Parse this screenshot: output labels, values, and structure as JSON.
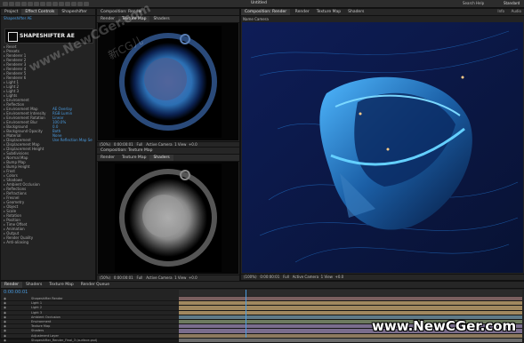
{
  "app": {
    "title": "Untitled",
    "workspace": "Standard",
    "search_placeholder": "Search Help"
  },
  "project_panel": {
    "tabs": [
      "Project",
      "Effect Controls",
      "Shapeshifter"
    ],
    "layer_title": "Shapeshifter AE",
    "logo_text": "SHAPESHIFTER AE",
    "rows": [
      "Reset",
      "Presets",
      "Renderer 1",
      "Renderer 2",
      "Renderer 3",
      "Renderer 4",
      "Renderer 5",
      "Renderer 6",
      "Light 1",
      "Light 2",
      "Light 3",
      "Lights",
      "Environment",
      "Reflection",
      "Environment Map",
      "Environment Intensity",
      "Environment Rotation",
      "Environment Blur",
      "Background",
      "Background Opacity",
      "Material",
      "Displacement",
      "Displacement Map",
      "Displacement Height",
      "Subdivisions",
      "Normal Map",
      "Bump Map",
      "Bump Height",
      "Frost",
      "Colors",
      "Shadows",
      "Ambient Occlusion",
      "Reflections",
      "Refractions",
      "Fresnel",
      "Geometry",
      "Object",
      "Scale",
      "Rotation",
      "Position",
      "Time Offset",
      "Animation",
      "Output",
      "Render Quality",
      "Anti-aliasing"
    ],
    "values": [
      "AE Overlay",
      "RGB Lumin",
      "Linear",
      "100.0%",
      "0.0",
      "Both",
      "None",
      "Use Reflection Map Settings"
    ]
  },
  "comp_top": {
    "tabs": [
      "Render",
      "Texture Map",
      "Shaders"
    ],
    "title": "Composition: Render",
    "footer": [
      "(50%)",
      "0:00:00:01",
      "Full",
      "Active Camera",
      "1 View",
      "+0.0"
    ]
  },
  "comp_bottom": {
    "tabs": [
      "Render",
      "Texture Map",
      "Shaders"
    ],
    "title": "Composition: Texture Map",
    "footer": [
      "(50%)",
      "0:00:00:01",
      "Full",
      "Active Camera",
      "1 View",
      "+0.0"
    ]
  },
  "comp_right": {
    "tabs": [
      "Render",
      "Texture Map",
      "Shaders"
    ],
    "title": "Composition: Render",
    "layer_label": "Name Camera",
    "side_labels": [
      "Info",
      "Audio"
    ],
    "footer": [
      "(100%)",
      "0:00:00:01",
      "Full",
      "Active Camera",
      "1 View",
      "+0.0"
    ]
  },
  "timeline": {
    "tabs": [
      "Render",
      "Shaders",
      "Texture Map",
      "Render Queue"
    ],
    "timecode": "0:00:00:01",
    "layers": [
      "Shapeshifter Render",
      "Light 1",
      "Light 2",
      "Light 3",
      "Ambient Occlusion",
      "Environment",
      "Texture Map",
      "Shaders",
      "Adjustment Layer",
      "Shapeshifter_Render_Final_3 (surface.psd)"
    ]
  },
  "watermarks": {
    "diagonal": "www.NewCGer.com",
    "chinese": "新CG儿",
    "bottom": "www.NewCGer.com"
  },
  "colors": {
    "accent": "#4a9be0",
    "render_bg": "#0b1a4c",
    "object_cyan": "#2f8fd6"
  }
}
